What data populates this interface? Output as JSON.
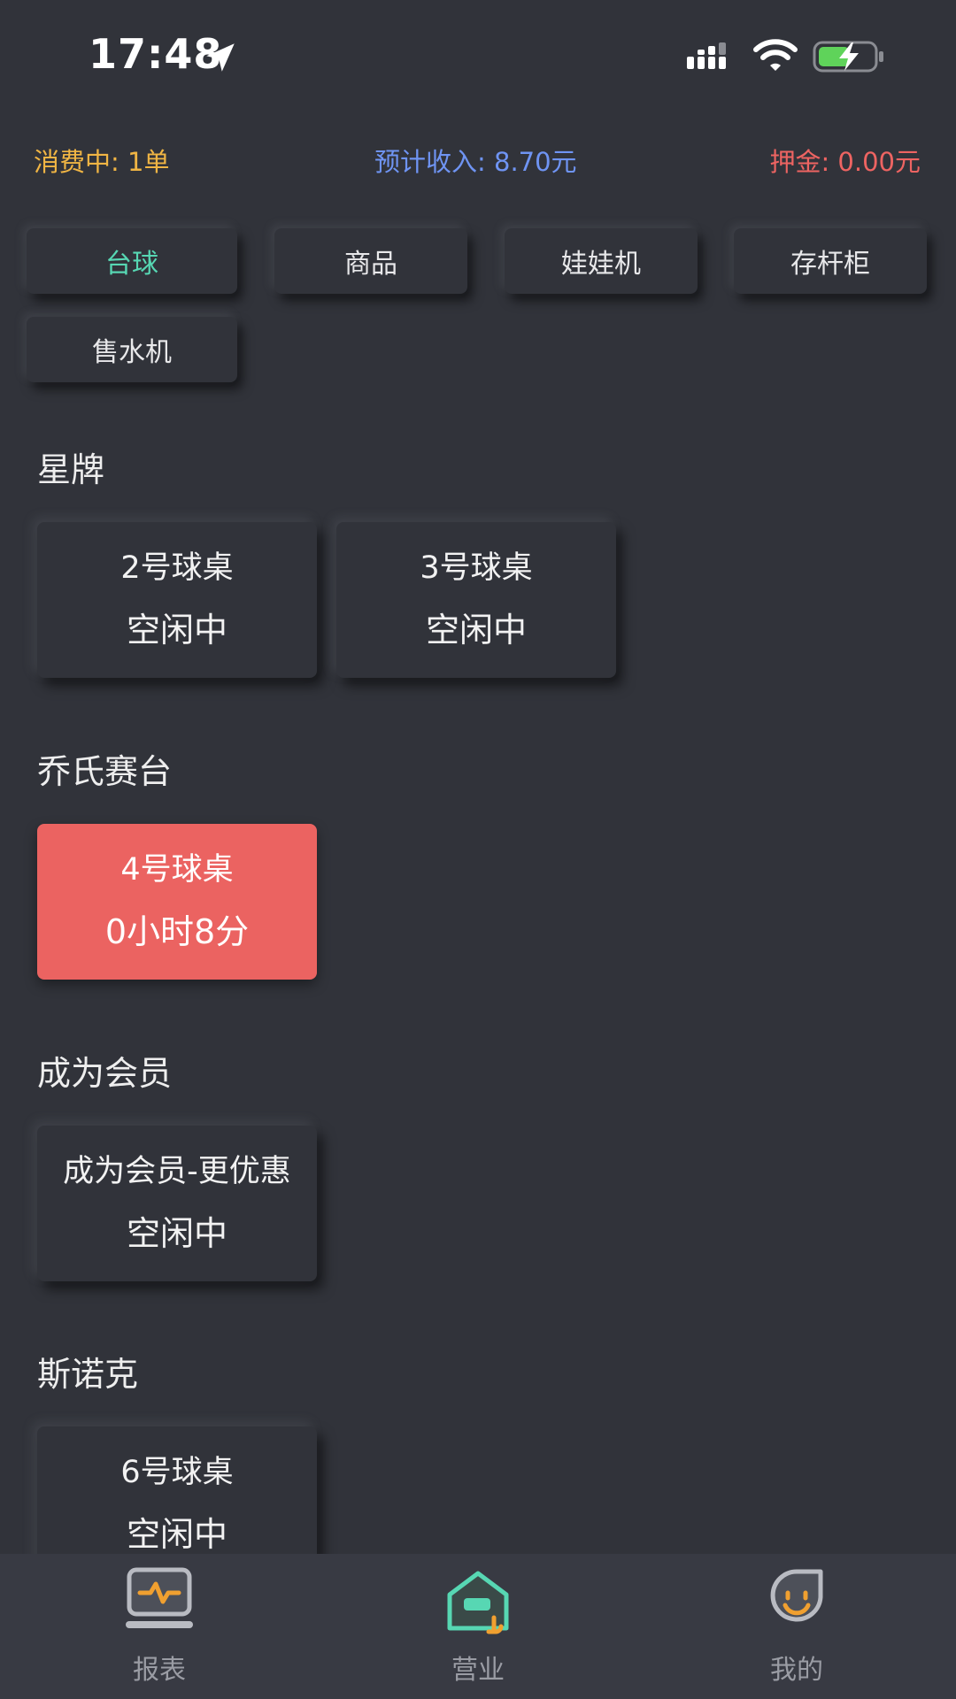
{
  "status_bar": {
    "time": "17:48",
    "icons": [
      "location-arrow-icon",
      "cellular-signal-icon",
      "wifi-icon",
      "battery-charging-icon"
    ]
  },
  "summary": {
    "consuming": "消费中: 1单",
    "income": "预计收入: 8.70元",
    "deposit": "押金: 0.00元",
    "colors": {
      "consuming": "#f0b544",
      "income": "#6f94f3",
      "deposit": "#ee6462"
    }
  },
  "tabs": [
    {
      "label": "台球",
      "active": true
    },
    {
      "label": "商品",
      "active": false
    },
    {
      "label": "娃娃机",
      "active": false
    },
    {
      "label": "存杆柜",
      "active": false
    },
    {
      "label": "售水机",
      "active": false
    }
  ],
  "sections": [
    {
      "title": "星牌",
      "tables": [
        {
          "name": "2号球桌",
          "state": "空闲中"
        },
        {
          "name": "3号球桌",
          "state": "空闲中"
        }
      ]
    },
    {
      "title": "乔氏赛台",
      "tables": [
        {
          "name": "4号球桌",
          "state": "0小时8分",
          "busy": true
        }
      ]
    },
    {
      "title": "成为会员",
      "tables": [
        {
          "name": "成为会员-更优惠",
          "state": "空闲中"
        }
      ]
    },
    {
      "title": "斯诺克",
      "tables": [
        {
          "name": "6号球桌",
          "state": "空闲中"
        }
      ]
    }
  ],
  "bottom_nav": [
    {
      "label": "报表",
      "icon": "report-monitor-icon"
    },
    {
      "label": "营业",
      "icon": "business-house-icon",
      "active": true
    },
    {
      "label": "我的",
      "icon": "profile-smile-icon"
    }
  ],
  "colors": {
    "background": "#31333a",
    "accent": "#57d7b3",
    "busy": "#eb6361",
    "nav_orange": "#f0a030"
  }
}
